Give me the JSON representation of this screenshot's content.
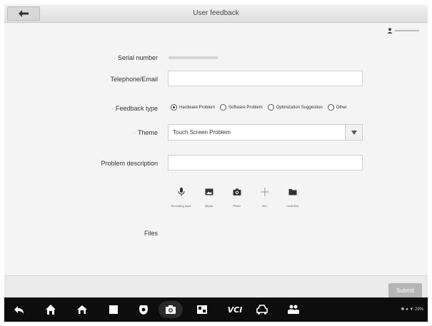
{
  "header": {
    "title": "User feedback"
  },
  "form": {
    "serial_label": "Serial number",
    "phone_label": "Telephone/Email",
    "type_label": "Feedback type",
    "types": [
      "Hardware Problem",
      "Software Problem",
      "Optimization Suggestion",
      "Other"
    ],
    "selected_type": "Hardware Problem",
    "theme_label": "Theme",
    "theme_value": "Touch Screen Problem",
    "desc_label": "Problem description",
    "files_label": "Files",
    "attachments": [
      "Recording input",
      "Album",
      "Photo",
      "Brd",
      "Local files"
    ]
  },
  "footer": {
    "submit_label": "Submit"
  },
  "statusbar": {
    "text": "29%"
  },
  "icons": {
    "back": "arrow-left-icon",
    "user": "user-icon",
    "mic": "microphone-icon",
    "album": "image-icon",
    "photo": "camera-icon",
    "add": "plus-icon",
    "folder": "folder-icon",
    "nav": [
      "back-icon",
      "home-icon",
      "house-icon",
      "square-icon",
      "browser-icon",
      "camera-icon",
      "screen-mirror-icon",
      "vci-icon",
      "car-icon",
      "people-icon"
    ]
  }
}
